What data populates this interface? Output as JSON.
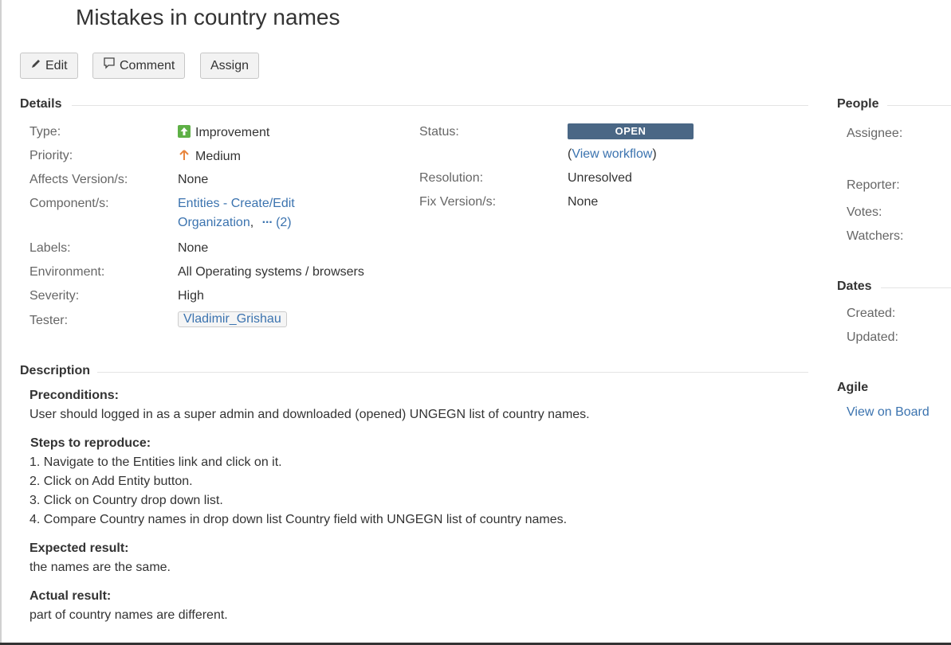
{
  "issue": {
    "title": "Mistakes in country names"
  },
  "toolbar": {
    "edit_label": "Edit",
    "comment_label": "Comment",
    "assign_label": "Assign"
  },
  "details": {
    "heading": "Details",
    "type_label": "Type:",
    "type_value": "Improvement",
    "priority_label": "Priority:",
    "priority_value": "Medium",
    "affects_label": "Affects Version/s:",
    "affects_value": "None",
    "component_label": "Component/s:",
    "component_line1": "Entities - Create/Edit",
    "component_line2": "Organization",
    "component_sep": ",",
    "component_more": "(2)",
    "labels_label": "Labels:",
    "labels_value": "None",
    "environment_label": "Environment:",
    "environment_value": "All Operating systems / browsers",
    "severity_label": "Severity:",
    "severity_value": "High",
    "tester_label": "Tester:",
    "tester_value": "Vladimir_Grishau",
    "status_label": "Status:",
    "status_value": "OPEN",
    "workflow_open": "(",
    "workflow_link": "View workflow",
    "workflow_close": ")",
    "resolution_label": "Resolution:",
    "resolution_value": "Unresolved",
    "fix_label": "Fix Version/s:",
    "fix_value": "None"
  },
  "people": {
    "heading": "People",
    "assignee_label": "Assignee:",
    "reporter_label": "Reporter:",
    "votes_label": "Votes:",
    "watchers_label": "Watchers:"
  },
  "dates": {
    "heading": "Dates",
    "created_label": "Created:",
    "updated_label": "Updated:"
  },
  "agile": {
    "heading": "Agile",
    "link": "View on Board"
  },
  "description": {
    "heading": "Description",
    "preconditions_title": "Preconditions:",
    "preconditions_text": "User should logged in as a super admin and downloaded (opened) UNGEGN list of country names.",
    "steps_title": "Steps to reproduce:",
    "steps": [
      "1. Navigate to the Entities link and click on it.",
      "2. Click on Add Entity button.",
      "3. Click on Country drop down list.",
      "4. Compare Country names in drop down list Country field with UNGEGN list of country names."
    ],
    "expected_title": "Expected result:",
    "expected_text": "the names are the same.",
    "actual_title": "Actual result:",
    "actual_text": "part of country names are different."
  },
  "colors": {
    "link": "#3b73af",
    "status_open": "#4a6785",
    "improvement": "#5eb046",
    "priority_medium": "#e8853d"
  },
  "icons": {
    "edit": "pencil-icon",
    "comment": "speech-bubble-icon",
    "type": "improvement-arrow-icon",
    "priority": "priority-up-arrow-icon"
  }
}
